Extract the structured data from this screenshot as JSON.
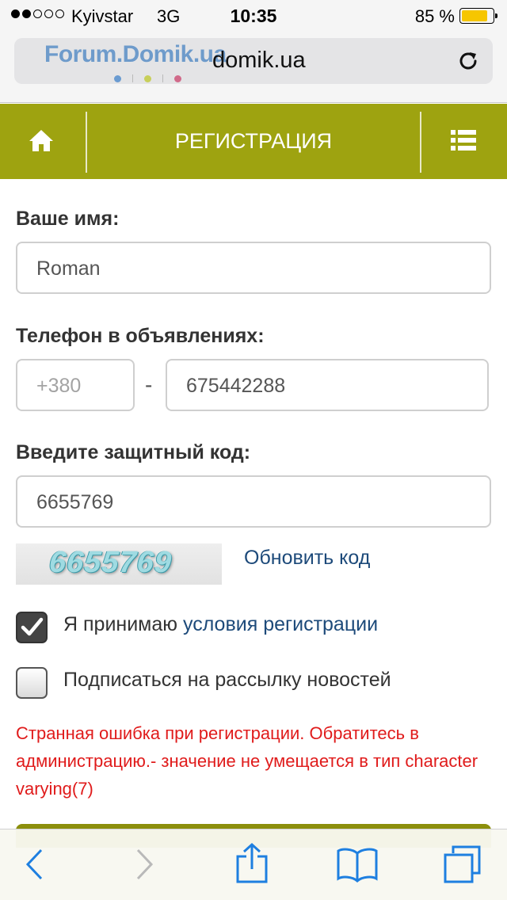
{
  "status_bar": {
    "carrier": "Kyivstar",
    "network": "3G",
    "time": "10:35",
    "battery_percent": "85 %",
    "battery_level": 0.85,
    "signal_bars": 2
  },
  "browser": {
    "domain": "domik.ua",
    "logo_text": "Forum.Domik.ua",
    "logo_dot_colors": [
      "#6a9bd1",
      "#c8cf5a",
      "#d16a8a"
    ]
  },
  "header": {
    "title": "РЕГИСТРАЦИЯ",
    "background": "#9ea310",
    "home_icon": "home-icon",
    "menu_icon": "list-icon"
  },
  "form": {
    "name_label": "Ваше имя:",
    "name_value": "Roman",
    "phone_label": "Телефон в объявлениях:",
    "phone_code_placeholder": "+380",
    "phone_separator": "-",
    "phone_number": "675442288",
    "captcha_label": "Введите защитный код:",
    "captcha_value": "6655769",
    "captcha_image_text": "6655769",
    "refresh_code": "Обновить код",
    "accept_prefix": "Я принимаю ",
    "accept_link": "условия регистрации",
    "accept_checked": true,
    "newsletter_label": "Подписаться на рассылку новостей",
    "newsletter_checked": false,
    "error_message": "Странная ошибка при регистрации. Обратитесь в администрацию.- значение не умещается в тип character varying(7)",
    "error_color": "#e01b1b",
    "link_color": "#1d4a7a"
  },
  "toolbar": {
    "icons": [
      "back-icon",
      "forward-icon",
      "share-icon",
      "bookmarks-icon",
      "tabs-icon"
    ],
    "accent": "#1e7fe0"
  }
}
